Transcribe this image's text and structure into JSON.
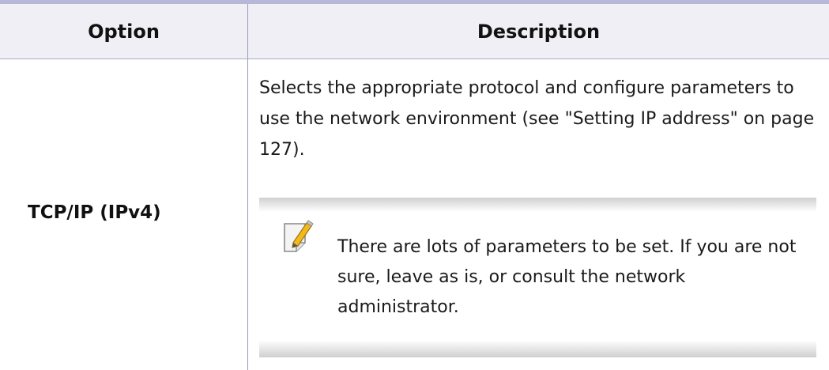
{
  "table": {
    "headers": {
      "option": "Option",
      "description": "Description"
    },
    "rows": [
      {
        "option": "TCP/IP (IPv4)",
        "description": "Selects the appropriate protocol and configure parameters to use the network environment (see \"Setting IP address\" on page 127).",
        "note": {
          "icon": "note-pencil-icon",
          "text": "There are lots of parameters to be set. If you are not sure, leave as is, or consult the network administrator."
        }
      }
    ]
  },
  "colors": {
    "header_background": "#efeff5",
    "top_rule": "#b7b8d7",
    "divider": "#9a9bbf"
  }
}
